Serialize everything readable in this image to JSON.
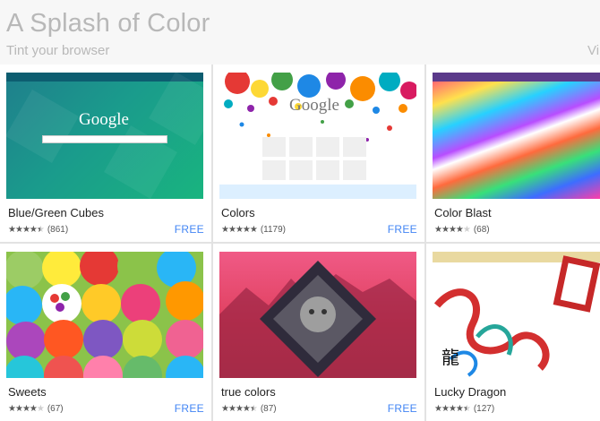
{
  "section": {
    "title": "A Splash of Color",
    "subtitle": "Tint your browser",
    "view_all": "Vi"
  },
  "themes": [
    {
      "name": "Blue/Green Cubes",
      "stars": 4.5,
      "count": "(861)",
      "price": "FREE",
      "preview_text": "Google"
    },
    {
      "name": "Colors",
      "stars": 5,
      "count": "(1179)",
      "price": "FREE",
      "preview_text": "Google"
    },
    {
      "name": "Color Blast",
      "stars": 4,
      "count": "(68)",
      "price": ""
    },
    {
      "name": "Sweets",
      "stars": 4,
      "count": "(67)",
      "price": "FREE"
    },
    {
      "name": "true colors",
      "stars": 4.5,
      "count": "(87)",
      "price": "FREE"
    },
    {
      "name": "Lucky Dragon",
      "stars": 4.5,
      "count": "(127)",
      "price": ""
    }
  ],
  "colors": {
    "price": "#4285f4",
    "title": "#b8b8b8",
    "star_on": "#5a5a5a",
    "star_off": "#cfcfcf"
  }
}
